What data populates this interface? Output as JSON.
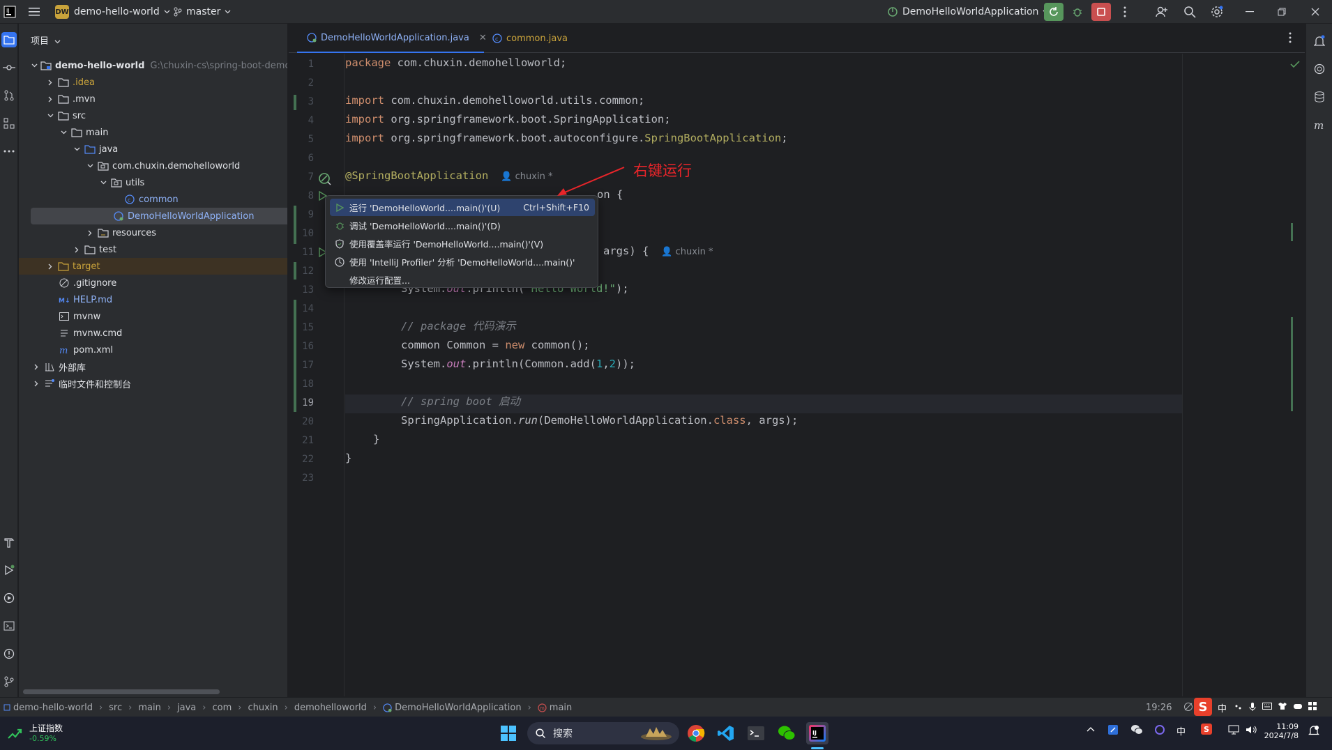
{
  "titlebar": {
    "project_badge": "DW",
    "project_name": "demo-hello-world",
    "branch": "master",
    "run_config": "DemoHelloWorldApplication"
  },
  "project_panel": {
    "title": "项目",
    "root": {
      "name": "demo-hello-world",
      "path": "G:\\chuxin-cs\\spring-boot-demo"
    },
    "items": [
      {
        "label": ".idea"
      },
      {
        "label": ".mvn"
      },
      {
        "label": "src"
      },
      {
        "label": "main"
      },
      {
        "label": "java"
      },
      {
        "label": "com.chuxin.demohelloworld"
      },
      {
        "label": "utils"
      },
      {
        "label": "common"
      },
      {
        "label": "DemoHelloWorldApplication"
      },
      {
        "label": "resources"
      },
      {
        "label": "test"
      },
      {
        "label": "target"
      },
      {
        "label": ".gitignore"
      },
      {
        "label": "HELP.md"
      },
      {
        "label": "mvnw"
      },
      {
        "label": "mvnw.cmd"
      },
      {
        "label": "pom.xml"
      },
      {
        "label": "外部库"
      },
      {
        "label": "临时文件和控制台"
      }
    ]
  },
  "tabs": [
    {
      "label": "DemoHelloWorldApplication.java"
    },
    {
      "label": "common.java"
    }
  ],
  "editor": {
    "line_numbers": [
      "1",
      "2",
      "3",
      "4",
      "5",
      "6",
      "7",
      "8",
      "9",
      "10",
      "11",
      "12",
      "13",
      "14",
      "15",
      "16",
      "17",
      "18",
      "19",
      "20",
      "21",
      "22",
      "23"
    ],
    "author": "chuxin *",
    "code": {
      "l1_kw": "package",
      "l1_rest": " com.chuxin.demohelloworld;",
      "l3_kw": "import",
      "l3_rest": " com.chuxin.demohelloworld.utils.common;",
      "l4_kw": "import",
      "l4_rest": " org.springframework.boot.SpringApplication;",
      "l5_kw": "import",
      "l5_rest": " org.springframework.boot.autoconfigure.",
      "l5_ann": "SpringBootApplication",
      "l5_end": ";",
      "l7_ann": "@SpringBootApplication",
      "l8_tail": "on {",
      "l11_tail": "args) {",
      "l13_a": "System.",
      "l13_out": "out",
      "l13_b": ".println(",
      "l13_str": "\"Hello World!\"",
      "l13_c": ");",
      "l15_cm": "// package 代码演示",
      "l16_a": "common Common = ",
      "l16_kw": "new",
      "l16_b": " common();",
      "l17_a": "System.",
      "l17_out": "out",
      "l17_b": ".println(Common.add(",
      "l17_n1": "1",
      "l17_comma": ",",
      "l17_n2": "2",
      "l17_c": "));",
      "l19_cm": "// spring boot 启动",
      "l20_a": "SpringApplication.",
      "l20_run": "run",
      "l20_b": "(DemoHelloWorldApplication.",
      "l20_kw": "class",
      "l20_c": ", args);",
      "l21": "}",
      "l22": "}"
    }
  },
  "annotation_label": "右键运行",
  "context_menu": {
    "items": [
      {
        "label": "运行 'DemoHelloWorld....main()'(U)",
        "shortcut": "Ctrl+Shift+F10"
      },
      {
        "label": "调试 'DemoHelloWorld....main()'(D)"
      },
      {
        "label": "使用覆盖率运行 'DemoHelloWorld....main()'(V)"
      },
      {
        "label": "使用 'IntelliJ Profiler' 分析 'DemoHelloWorld....main()'"
      },
      {
        "label": "修改运行配置..."
      }
    ]
  },
  "breadcrumb": [
    "demo-hello-world",
    "src",
    "main",
    "java",
    "com",
    "chuxin",
    "demohelloworld",
    "DemoHelloWorldApplication",
    "main"
  ],
  "status": {
    "position": "19:26",
    "ime": "中"
  },
  "taskbar": {
    "stock_name": "上证指数",
    "stock_change": "-0.59%",
    "search_placeholder": "搜索",
    "time": "11:09",
    "date": "2024/7/8",
    "ime": "中"
  }
}
